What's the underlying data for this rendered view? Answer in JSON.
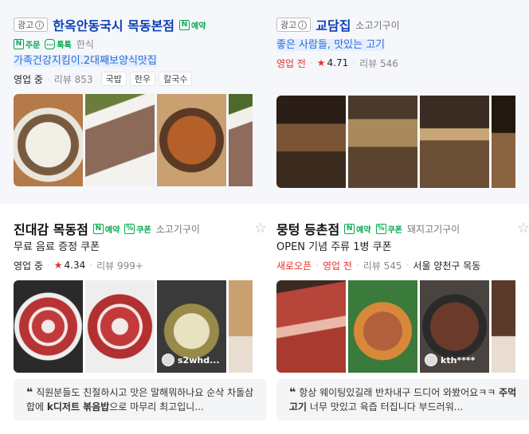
{
  "cards": [
    {
      "ad_label": "광고",
      "name": "한옥안동국시 목동본점",
      "badges": [
        "예약"
      ],
      "sub_badges": [
        "주문",
        "톡톡"
      ],
      "category": "한식",
      "slogan": "가족건강지킴이.2대째보양식맛집",
      "status": "영업 중",
      "reviews": "리뷰 853",
      "tags": [
        "국밥",
        "한우",
        "칼국수"
      ]
    },
    {
      "ad_label": "광고",
      "name": "교담집",
      "category": "소고기구이",
      "slogan": "좋은 사람들, 맛있는 고기",
      "status": "영업 전",
      "rating": "4.71",
      "reviews": "리뷰 546"
    },
    {
      "name": "진대감 목동점",
      "badges": [
        "예약",
        "쿠폰"
      ],
      "category": "소고기구이",
      "slogan": "무료 음료 증정 쿠폰",
      "status": "영업 중",
      "rating": "4.34",
      "reviews": "리뷰 999+",
      "photo_owner": "s2whd...",
      "review_a": "직원분들도 친절하시고 맛은 말해뭐하나요 순삭 차돌삼합에 ",
      "review_b": "k디저트 볶음밥",
      "review_c": "으로 마무리 최고입니..."
    },
    {
      "name": "뭉텅 등촌점",
      "badges": [
        "예약",
        "쿠폰"
      ],
      "category": "돼지고기구이",
      "slogan": "OPEN 기념 주류 1병 쿠폰",
      "new_label": "새로오픈",
      "status": "영업 전",
      "reviews": "리뷰 545",
      "address": "서울 양천구 목동",
      "photo_owner": "kth****",
      "review_a": "항상 웨이팅있길래 반차내구 드디어 와봤어요ㅋㅋ ",
      "review_b": "주먹고기",
      "review_c": " 너무 맛있고 육즙 터집니다 부드러워..."
    }
  ],
  "star_icon": "★",
  "bookmark_icon": "☆",
  "colors": {
    "link": "#0c3fb5",
    "naver_green": "#03a94c",
    "red": "#e8312b",
    "slogan_blue": "#2a6bd8"
  }
}
